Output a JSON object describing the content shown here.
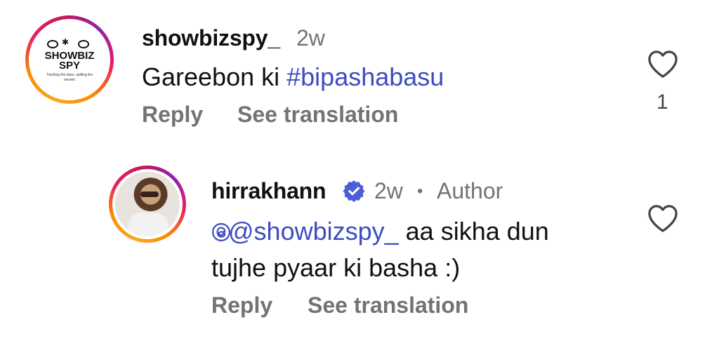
{
  "comments": [
    {
      "username": "showbizspy_",
      "time": "2w",
      "text_plain": "Gareebon ki ",
      "text_tag": "#bipashabasu",
      "reply_label": "Reply",
      "translate_label": "See translation",
      "likes": "1",
      "avatar": {
        "logo_line1": "SHOWBIZ",
        "logo_line2": "SPY",
        "logo_tagline": "Tracking the stars, spilling the secrets"
      }
    },
    {
      "username": "hirrakhann",
      "time": "2w",
      "separator": "•",
      "author_badge": "Author",
      "mention": "@showbizspy_",
      "text_line1": " aa sikha dun",
      "text_line2": "tujhe pyaar ki basha :)",
      "reply_label": "Reply",
      "translate_label": "See translation"
    }
  ],
  "icons": {
    "heart": "heart-outline-icon",
    "verified": "verified-badge-icon",
    "threads": "threads-icon"
  },
  "colors": {
    "link": "#3d4dbf",
    "muted": "#737373",
    "verified": "#4a5fd6"
  }
}
